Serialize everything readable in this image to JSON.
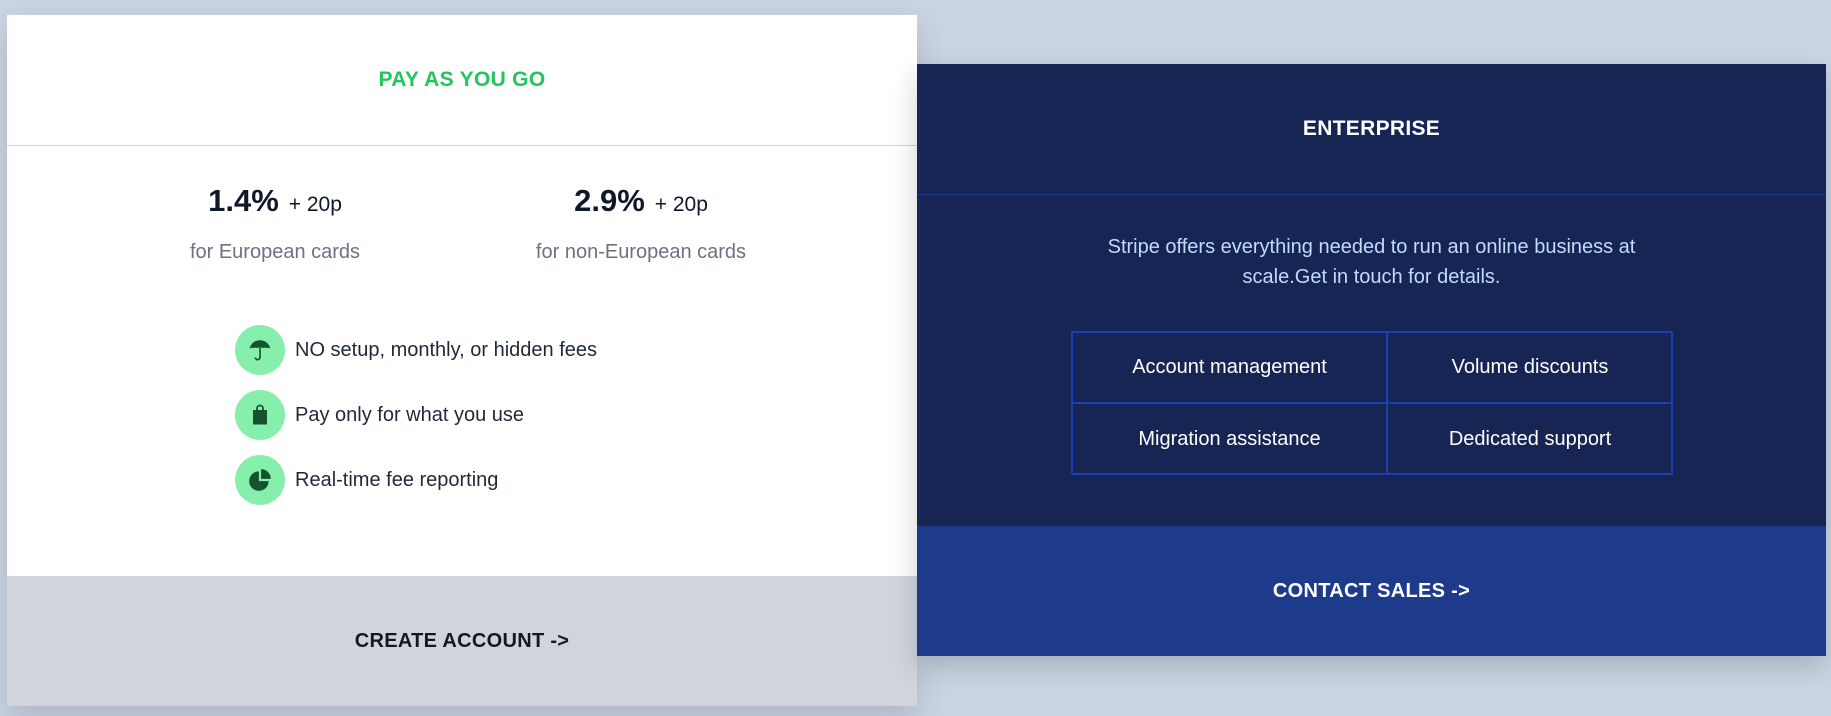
{
  "pay_as_you_go": {
    "title": "PAY AS YOU GO",
    "accent_color": "#22c55e",
    "prices": [
      {
        "percent": "1.4%",
        "fixed": "+ 20p",
        "description": "for European cards"
      },
      {
        "percent": "2.9%",
        "fixed": "+ 20p",
        "description": "for non-European cards"
      }
    ],
    "features": [
      {
        "icon": "umbrella-icon",
        "text": "NO setup, monthly, or hidden fees"
      },
      {
        "icon": "shopping-bag-icon",
        "text": "Pay only for what you use"
      },
      {
        "icon": "pie-chart-icon",
        "text": "Real-time fee reporting"
      }
    ],
    "cta_label": "CREATE ACCOUNT ->"
  },
  "enterprise": {
    "title": "ENTERPRISE",
    "description_line1": "Stripe offers everything needed to run an online business at",
    "description_line2": "scale.Get in touch for details.",
    "services": [
      "Account management",
      "Volume discounts",
      "Migration assistance",
      "Dedicated support"
    ],
    "cta_label": "CONTACT SALES ->",
    "bg_color": "#172554",
    "cta_color": "#1e3a8a"
  }
}
